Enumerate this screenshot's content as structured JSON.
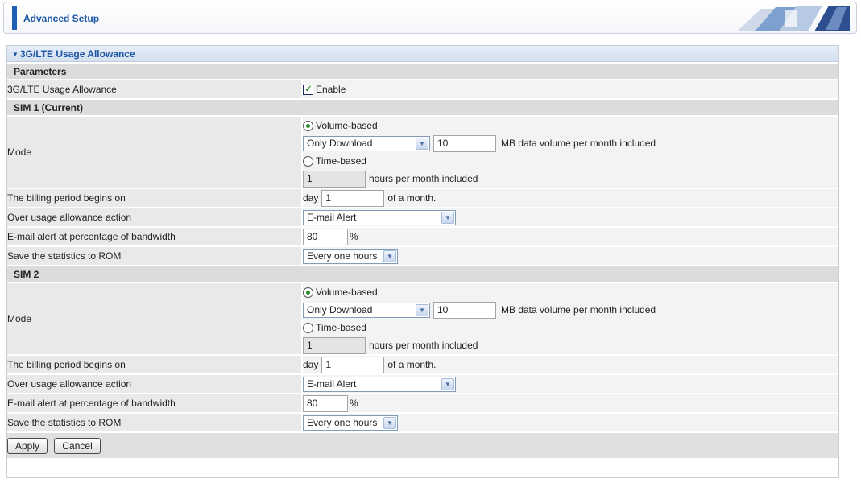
{
  "header": {
    "title": "Advanced Setup"
  },
  "panel": {
    "title": "3G/LTE Usage Allowance"
  },
  "parameters": {
    "section": "Parameters",
    "allowance_label": "3G/LTE Usage Allowance",
    "enable_label": "Enable",
    "enable_checked": true
  },
  "sims": [
    {
      "section": "SIM 1 (Current)",
      "mode_label": "Mode",
      "volume_label": "Volume-based",
      "volume_selected": true,
      "volume_type": "Only Download",
      "volume_value": "10",
      "volume_suffix": "MB data volume per month included",
      "time_label": "Time-based",
      "time_selected": false,
      "time_value": "1",
      "time_suffix": "hours per month included",
      "billing_label": "The billing period begins on",
      "billing_prefix": "day",
      "billing_value": "1",
      "billing_suffix": "of a month.",
      "over_label": "Over usage allowance action",
      "over_value": "E-mail Alert",
      "email_label": "E-mail alert at percentage of bandwidth",
      "email_value": "80",
      "email_suffix": "%",
      "save_label": "Save the statistics to ROM",
      "save_value": "Every one hours"
    },
    {
      "section": "SIM 2",
      "mode_label": "Mode",
      "volume_label": "Volume-based",
      "volume_selected": true,
      "volume_type": "Only Download",
      "volume_value": "10",
      "volume_suffix": "MB data volume per month included",
      "time_label": "Time-based",
      "time_selected": false,
      "time_value": "1",
      "time_suffix": "hours per month included",
      "billing_label": "The billing period begins on",
      "billing_prefix": "day",
      "billing_value": "1",
      "billing_suffix": "of a month.",
      "over_label": "Over usage allowance action",
      "over_value": "E-mail Alert",
      "email_label": "E-mail alert at percentage of bandwidth",
      "email_value": "80",
      "email_suffix": "%",
      "save_label": "Save the statistics to ROM",
      "save_value": "Every one hours"
    }
  ],
  "buttons": {
    "apply": "Apply",
    "cancel": "Cancel"
  },
  "colors": {
    "accent": "#1f5fb3",
    "title_text": "#1c56a8"
  }
}
